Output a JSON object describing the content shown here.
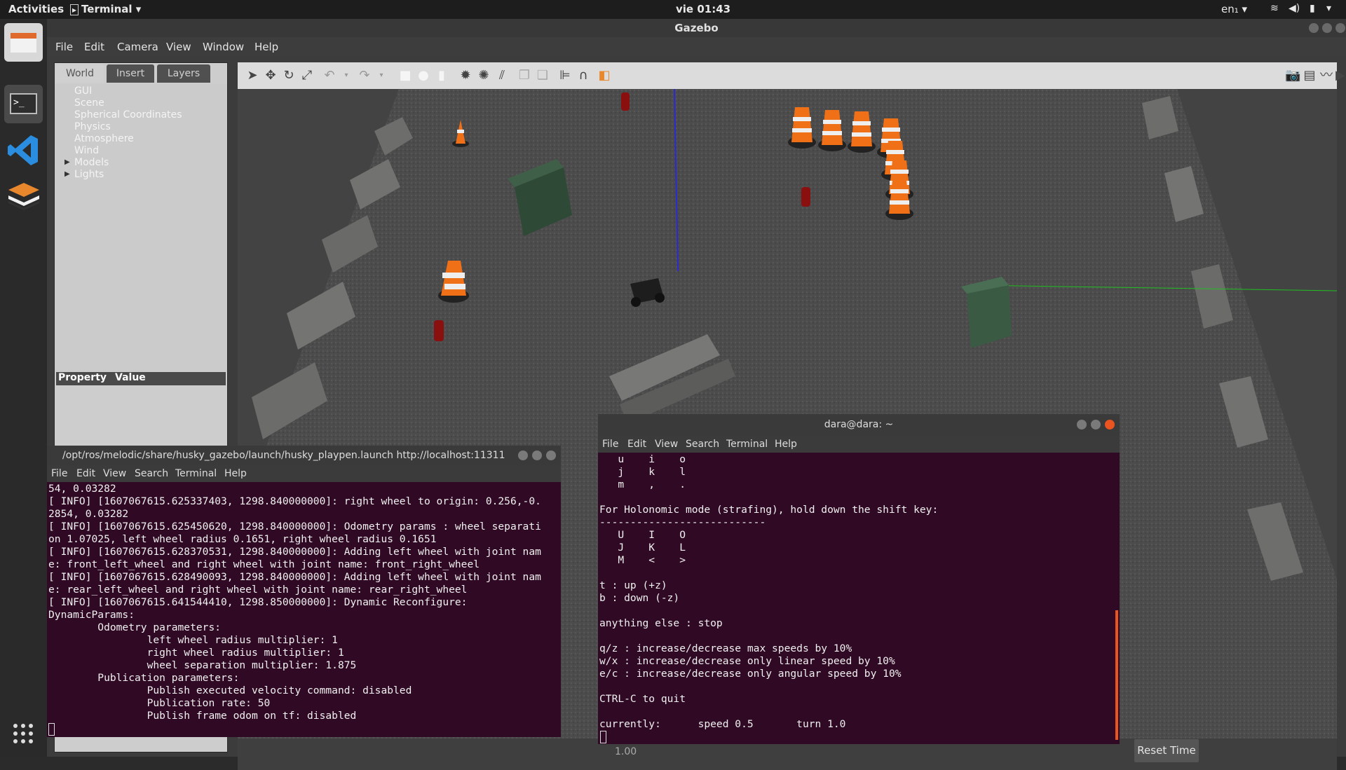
{
  "topbar": {
    "activities": "Activities",
    "app_name": "Terminal",
    "clock": "vie 01:43",
    "lang": "en₁"
  },
  "gazebo": {
    "title": "Gazebo",
    "menu": [
      "File",
      "Edit",
      "Camera",
      "View",
      "Window",
      "Help"
    ],
    "tabs": [
      "World",
      "Insert",
      "Layers"
    ],
    "tree": [
      "GUI",
      "Scene",
      "Spherical Coordinates",
      "Physics",
      "Atmosphere",
      "Wind",
      "Models",
      "Lights"
    ],
    "property_header": {
      "property": "Property",
      "value": "Value"
    },
    "reset_time": "Reset Time",
    "real_time_factor": "1.00"
  },
  "term_left": {
    "title": "/opt/ros/melodic/share/husky_gazebo/launch/husky_playpen.launch http://localhost:11311",
    "menu": [
      "File",
      "Edit",
      "View",
      "Search",
      "Terminal",
      "Help"
    ],
    "lines": [
      "54, 0.03282",
      "[ INFO] [1607067615.625337403, 1298.840000000]: right wheel to origin: 0.256,-0.",
      "2854, 0.03282",
      "[ INFO] [1607067615.625450620, 1298.840000000]: Odometry params : wheel separati",
      "on 1.07025, left wheel radius 0.1651, right wheel radius 0.1651",
      "[ INFO] [1607067615.628370531, 1298.840000000]: Adding left wheel with joint nam",
      "e: front_left_wheel and right wheel with joint name: front_right_wheel",
      "[ INFO] [1607067615.628490093, 1298.840000000]: Adding left wheel with joint nam",
      "e: rear_left_wheel and right wheel with joint name: rear_right_wheel",
      "[ INFO] [1607067615.641544410, 1298.850000000]: Dynamic Reconfigure:",
      "DynamicParams:",
      "        Odometry parameters:",
      "                left wheel radius multiplier: 1",
      "                right wheel radius multiplier: 1",
      "                wheel separation multiplier: 1.875",
      "        Publication parameters:",
      "                Publish executed velocity command: disabled",
      "                Publication rate: 50",
      "                Publish frame odom on tf: disabled"
    ]
  },
  "term_right": {
    "title": "dara@dara: ~",
    "menu": [
      "File",
      "Edit",
      "View",
      "Search",
      "Terminal",
      "Help"
    ],
    "lines": [
      "   u    i    o",
      "   j    k    l",
      "   m    ,    .",
      "",
      "For Holonomic mode (strafing), hold down the shift key:",
      "---------------------------",
      "   U    I    O",
      "   J    K    L",
      "   M    <    >",
      "",
      "t : up (+z)",
      "b : down (-z)",
      "",
      "anything else : stop",
      "",
      "q/z : increase/decrease max speeds by 10%",
      "w/x : increase/decrease only linear speed by 10%",
      "e/c : increase/decrease only angular speed by 10%",
      "",
      "CTRL-C to quit",
      "",
      "currently:      speed 0.5       turn 1.0"
    ]
  }
}
